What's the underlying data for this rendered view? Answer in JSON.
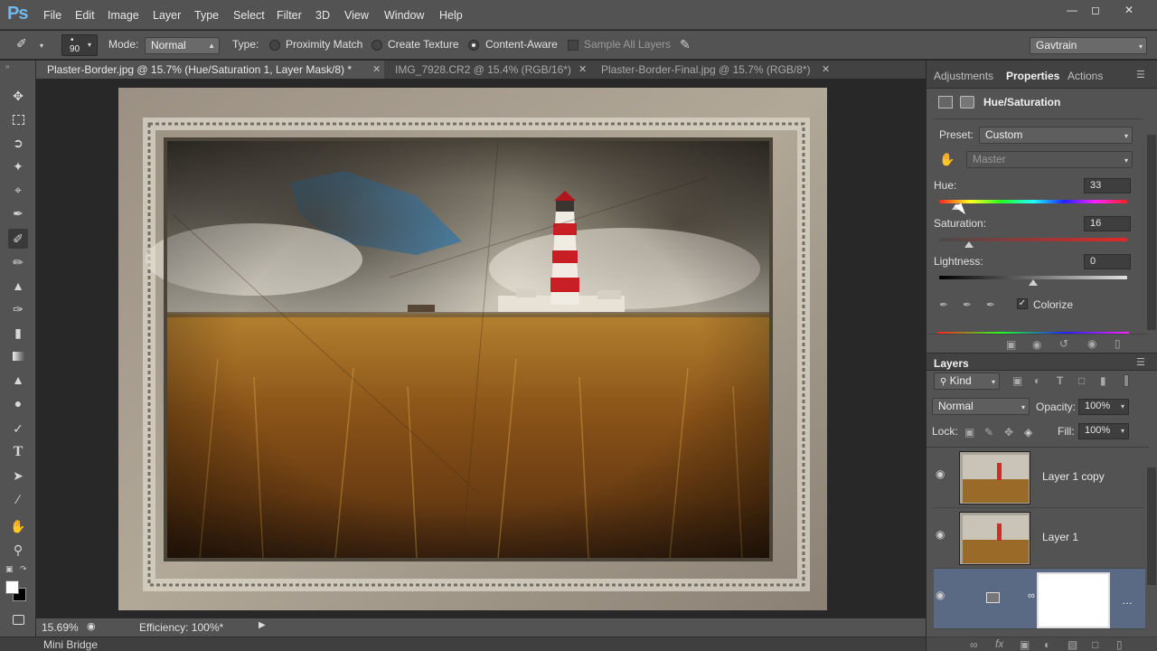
{
  "app": {
    "logo": "Ps"
  },
  "menu": [
    "File",
    "Edit",
    "Image",
    "Layer",
    "Type",
    "Select",
    "Filter",
    "3D",
    "View",
    "Window",
    "Help"
  ],
  "options": {
    "brush_size": "90",
    "mode_label": "Mode:",
    "mode_value": "Normal",
    "type_label": "Type:",
    "type_options": [
      "Proximity Match",
      "Create Texture",
      "Content-Aware"
    ],
    "type_selected": "Content-Aware",
    "sample_all_layers": "Sample All Layers",
    "workspace": "Gavtrain"
  },
  "tabs": [
    {
      "label": "Plaster-Border.jpg @ 15.7% (Hue/Saturation 1, Layer Mask/8) *",
      "active": true
    },
    {
      "label": "IMG_7928.CR2 @ 15.4% (RGB/16*)",
      "active": false
    },
    {
      "label": "Plaster-Border-Final.jpg @ 15.7% (RGB/8*)",
      "active": false
    }
  ],
  "status": {
    "zoom": "15.69%",
    "efficiency": "Efficiency: 100%*"
  },
  "minibridge": {
    "label": "Mini Bridge"
  },
  "panels": {
    "tabs": [
      "Adjustments",
      "Properties",
      "Actions"
    ],
    "active_tab": "Properties",
    "adjustment_title": "Hue/Saturation",
    "preset_label": "Preset:",
    "preset_value": "Custom",
    "channel_value": "Master",
    "hue_label": "Hue:",
    "hue_value": "33",
    "saturation_label": "Saturation:",
    "saturation_value": "16",
    "lightness_label": "Lightness:",
    "lightness_value": "0",
    "colorize_label": "Colorize",
    "colorize_checked": true,
    "hue_fraction": 0.09,
    "saturation_fraction": 0.16,
    "lightness_fraction": 0.5
  },
  "layers": {
    "title": "Layers",
    "kind_label": "Kind",
    "blend_mode": "Normal",
    "opacity_label": "Opacity:",
    "opacity_value": "100%",
    "lock_label": "Lock:",
    "fill_label": "Fill:",
    "fill_value": "100%",
    "items": [
      {
        "name": "Layer 1 copy"
      },
      {
        "name": "Layer 1"
      },
      {
        "name": ""
      }
    ]
  }
}
